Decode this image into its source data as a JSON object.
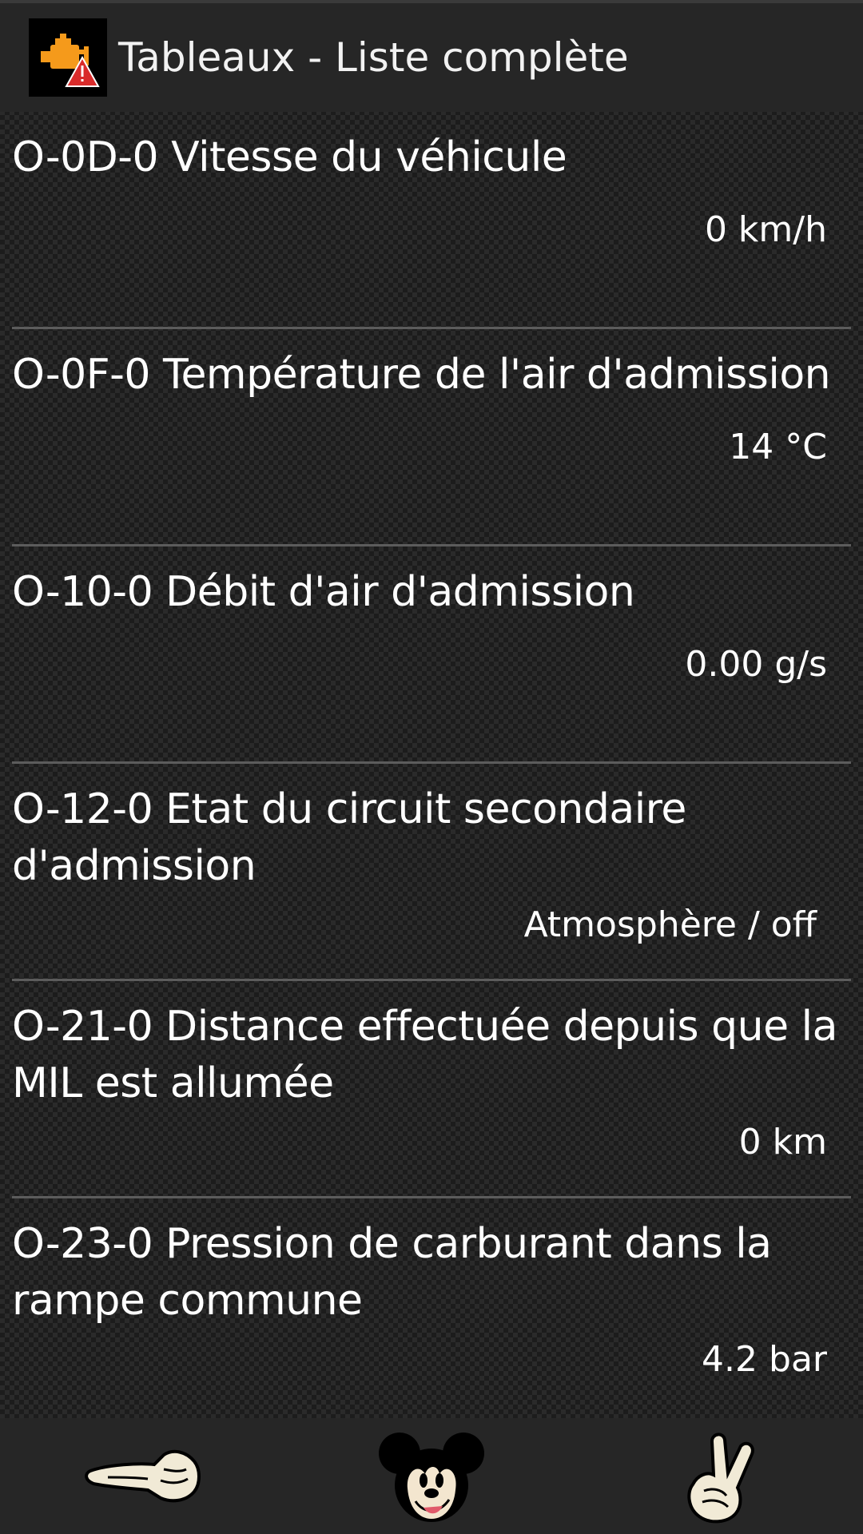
{
  "header": {
    "title": "Tableaux - Liste complète",
    "icon": "check-engine-warning-icon",
    "icon_color": "#f59a1b",
    "warning_color": "#d92b2b"
  },
  "items": [
    {
      "title": "O-0D-0 Vitesse du véhicule",
      "value": "0 km/h"
    },
    {
      "title": "O-0F-0 Température de l'air d'admission",
      "value": "14 °C"
    },
    {
      "title": "O-10-0 Débit d'air d'admission",
      "value": "0.00 g/s"
    },
    {
      "title": "O-12-0 Etat du circuit secondaire d'admission",
      "value": "Atmosphère / off"
    },
    {
      "title": "O-21-0 Distance effectuée depuis que la MIL est allumée",
      "value": "0 km"
    },
    {
      "title": "O-23-0 Pression de carburant dans la rampe commune",
      "value": "4.2 bar"
    }
  ],
  "bottom_nav": {
    "left_icon": "pointing-left-hand-icon",
    "center_icon": "mickey-face-icon",
    "right_icon": "victory-hand-icon"
  }
}
